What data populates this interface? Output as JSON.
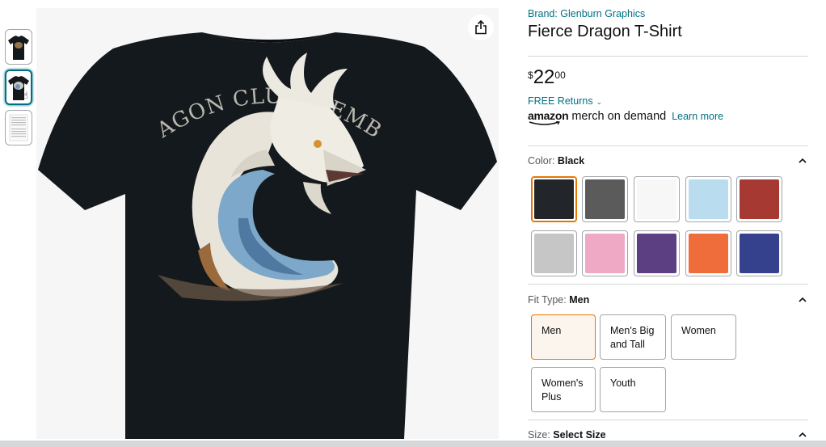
{
  "gallery": {
    "thumbnails": [
      {
        "name": "thumb-front",
        "selected": false
      },
      {
        "name": "thumb-back",
        "selected": true
      },
      {
        "name": "thumb-size-chart",
        "selected": false
      }
    ],
    "main_image": {
      "print_text": "DRAGON CLUB MEMBER",
      "shirt_color": "#14191d",
      "background": "#f6f6f6"
    },
    "share_icon": "share-icon"
  },
  "product": {
    "brand": "Brand: Glenburn Graphics",
    "title": "Fierce Dragon T-Shirt",
    "price": {
      "symbol": "$",
      "whole": "22",
      "fraction": "00"
    },
    "returns": "FREE Returns",
    "merch_logo": "amazon",
    "merch_text": "merch on demand",
    "learn_more": "Learn more"
  },
  "color": {
    "label": "Color:",
    "selected": "Black",
    "swatches": [
      {
        "name": "Black",
        "hex": "#22262b",
        "selected": true
      },
      {
        "name": "Asphalt",
        "hex": "#5a5b5a"
      },
      {
        "name": "White",
        "hex": "#f7f7f7"
      },
      {
        "name": "Baby Blue",
        "hex": "#b9dcef"
      },
      {
        "name": "Red",
        "hex": "#a63a33"
      },
      {
        "name": "Heather Grey",
        "hex": "#c6c6c6"
      },
      {
        "name": "Pink",
        "hex": "#efa9c4"
      },
      {
        "name": "Purple",
        "hex": "#5b3f82"
      },
      {
        "name": "Orange",
        "hex": "#ee6d3a"
      },
      {
        "name": "Royal Blue",
        "hex": "#35418d"
      }
    ]
  },
  "fit": {
    "label": "Fit Type:",
    "selected": "Men",
    "options": [
      "Men",
      "Men's Big and Tall",
      "Women",
      "Women's Plus",
      "Youth"
    ]
  },
  "size": {
    "label": "Size:",
    "value": "Select Size"
  },
  "colors": {
    "link": "#007185",
    "selected_border": "#e77600",
    "divider": "#d5d9d9"
  }
}
